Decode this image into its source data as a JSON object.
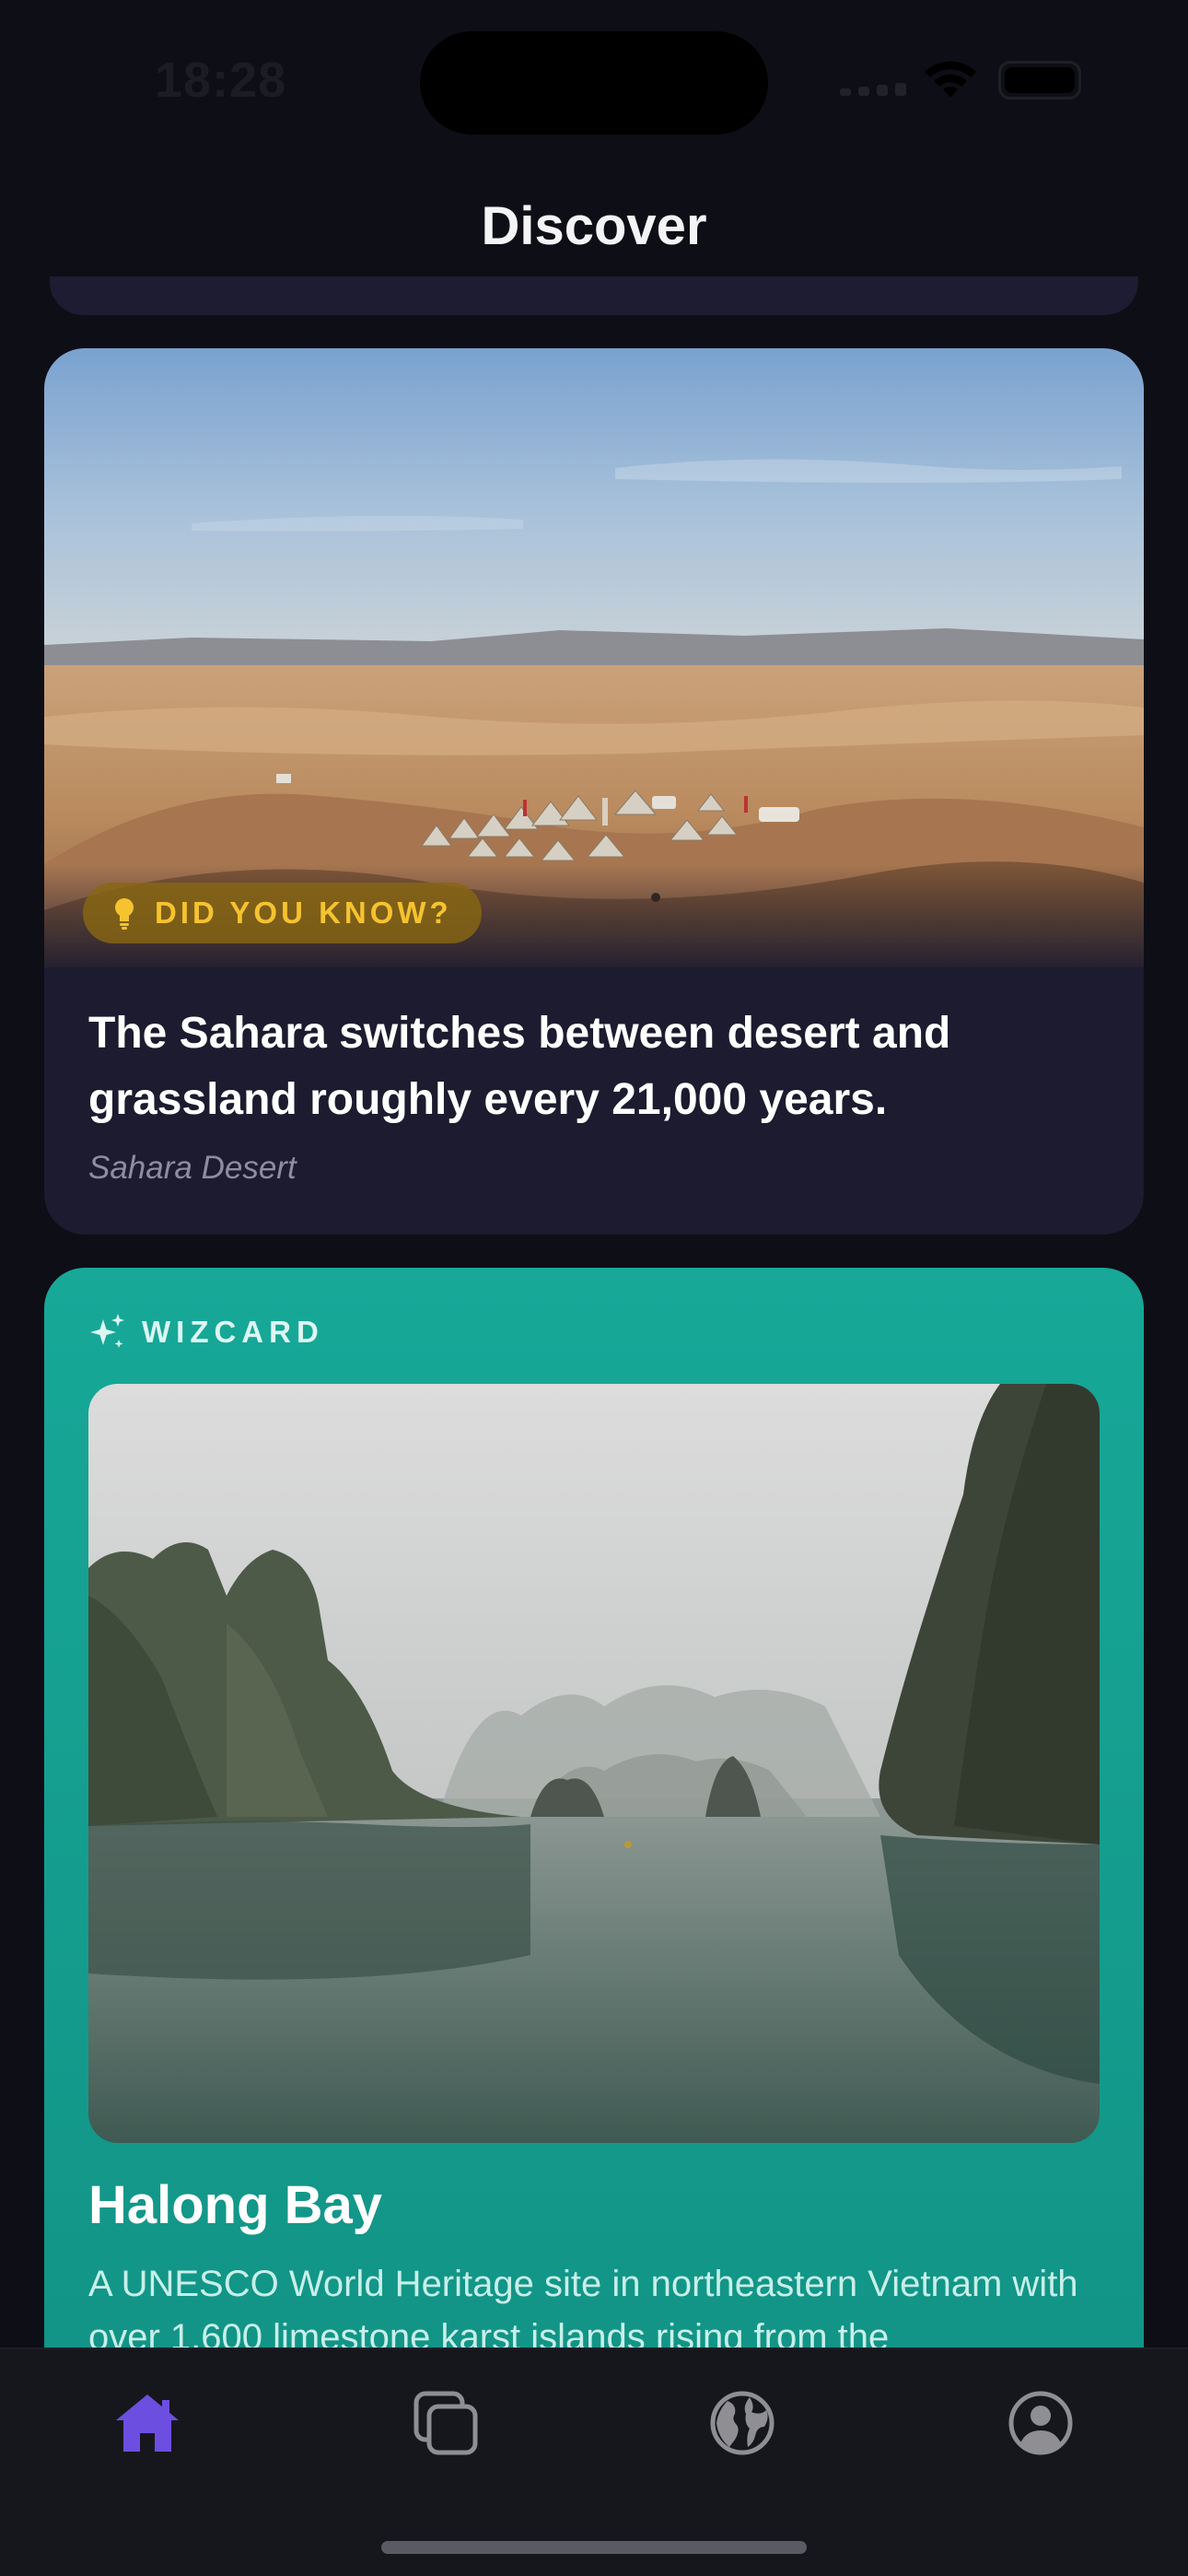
{
  "status_bar": {
    "time": "18:28"
  },
  "header": {
    "title": "Discover"
  },
  "fact_card": {
    "badge": "DID YOU KNOW?",
    "text": "The Sahara switches between desert and grassland roughly every 21,000 years.",
    "location": "Sahara Desert",
    "badge_color": "#f5c330",
    "image": "sahara-desert-camp-photo"
  },
  "wizcard": {
    "label": "WIZCARD",
    "title": "Halong Bay",
    "description": "A UNESCO World Heritage site in northeastern Vietnam with over 1,600 limestone karst islands rising from the",
    "accent_color": "#17a898",
    "image": "halong-bay-photo"
  },
  "tab_bar": {
    "active_color": "#6c4fe0",
    "inactive_color": "#8e8e93",
    "tabs": [
      {
        "icon": "home-icon",
        "active": true
      },
      {
        "icon": "cards-icon",
        "active": false
      },
      {
        "icon": "globe-icon",
        "active": false
      },
      {
        "icon": "profile-icon",
        "active": false
      }
    ]
  }
}
